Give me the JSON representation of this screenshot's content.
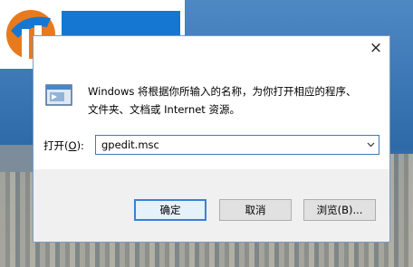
{
  "dialog": {
    "description_line1": "Windows 将根据你所输入的名称，为你打开相应的程序、",
    "description_line2": "文件夹、文档或 Internet 资源。",
    "open_label_prefix": "打开(",
    "open_label_hotkey": "O",
    "open_label_suffix": "):",
    "input_value": "gpedit.msc",
    "ok_label": "确定",
    "cancel_label": "取消",
    "browse_label": "浏览(B)...",
    "close_glyph": "×"
  },
  "icons": {
    "close": "close-icon",
    "app": "run-app-icon",
    "dropdown": "chevron-down-icon",
    "logo": "site-logo"
  },
  "colors": {
    "dialog_border": "#7a9cc6",
    "input_border": "#3b79c4",
    "primary_button_border": "#3c7fd6",
    "logo_blue": "#1677d2",
    "logo_olive": "#7a6a08"
  }
}
